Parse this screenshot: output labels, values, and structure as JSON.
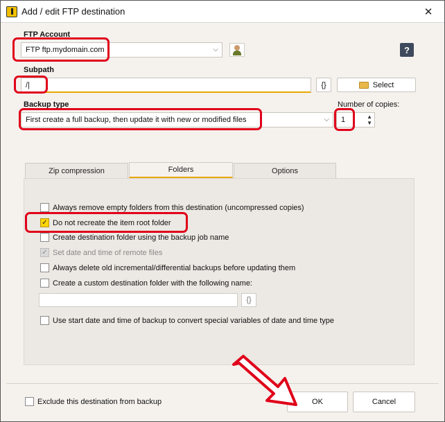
{
  "window": {
    "title": "Add / edit FTP destination",
    "close_glyph": "✕"
  },
  "ftp_account": {
    "label": "FTP Account",
    "selected": "FTP ftp.mydomain.com",
    "help_glyph": "?"
  },
  "subpath": {
    "label": "Subpath",
    "value": "/|",
    "braces_label": "{}",
    "select_label": "Select"
  },
  "backup_type": {
    "label": "Backup type",
    "selected": "First create a full backup, then update it with new or modified files"
  },
  "copies": {
    "label": "Number of copies:",
    "value": "1"
  },
  "tabs": [
    {
      "label": "Zip compression",
      "active": false
    },
    {
      "label": "Folders",
      "active": true
    },
    {
      "label": "Options",
      "active": false
    }
  ],
  "options": [
    {
      "label": "Always remove empty folders from this destination (uncompressed copies)",
      "checked": false,
      "disabled": false
    },
    {
      "label": "Do not recreate the item root folder",
      "checked": true,
      "disabled": false
    },
    {
      "label": "Create destination folder using the backup job name",
      "checked": false,
      "disabled": false
    },
    {
      "label": "Set date and time of remote files",
      "checked": true,
      "disabled": true
    },
    {
      "label": "Always delete old incremental/differential backups before updating them",
      "checked": false,
      "disabled": false
    },
    {
      "label": "Create a custom destination folder with the following name:",
      "checked": false,
      "disabled": false
    },
    {
      "label": "Use start date and time of backup to convert special variables of date and time type",
      "checked": false,
      "disabled": false
    }
  ],
  "custom_folder": {
    "value": "",
    "braces_label": "{}"
  },
  "footer": {
    "exclude_label": "Exclude this destination from backup",
    "ok_label": "OK",
    "cancel_label": "Cancel"
  },
  "colors": {
    "accent": "#e8a800",
    "highlight": "#e0001a",
    "check": "#ffd400"
  }
}
